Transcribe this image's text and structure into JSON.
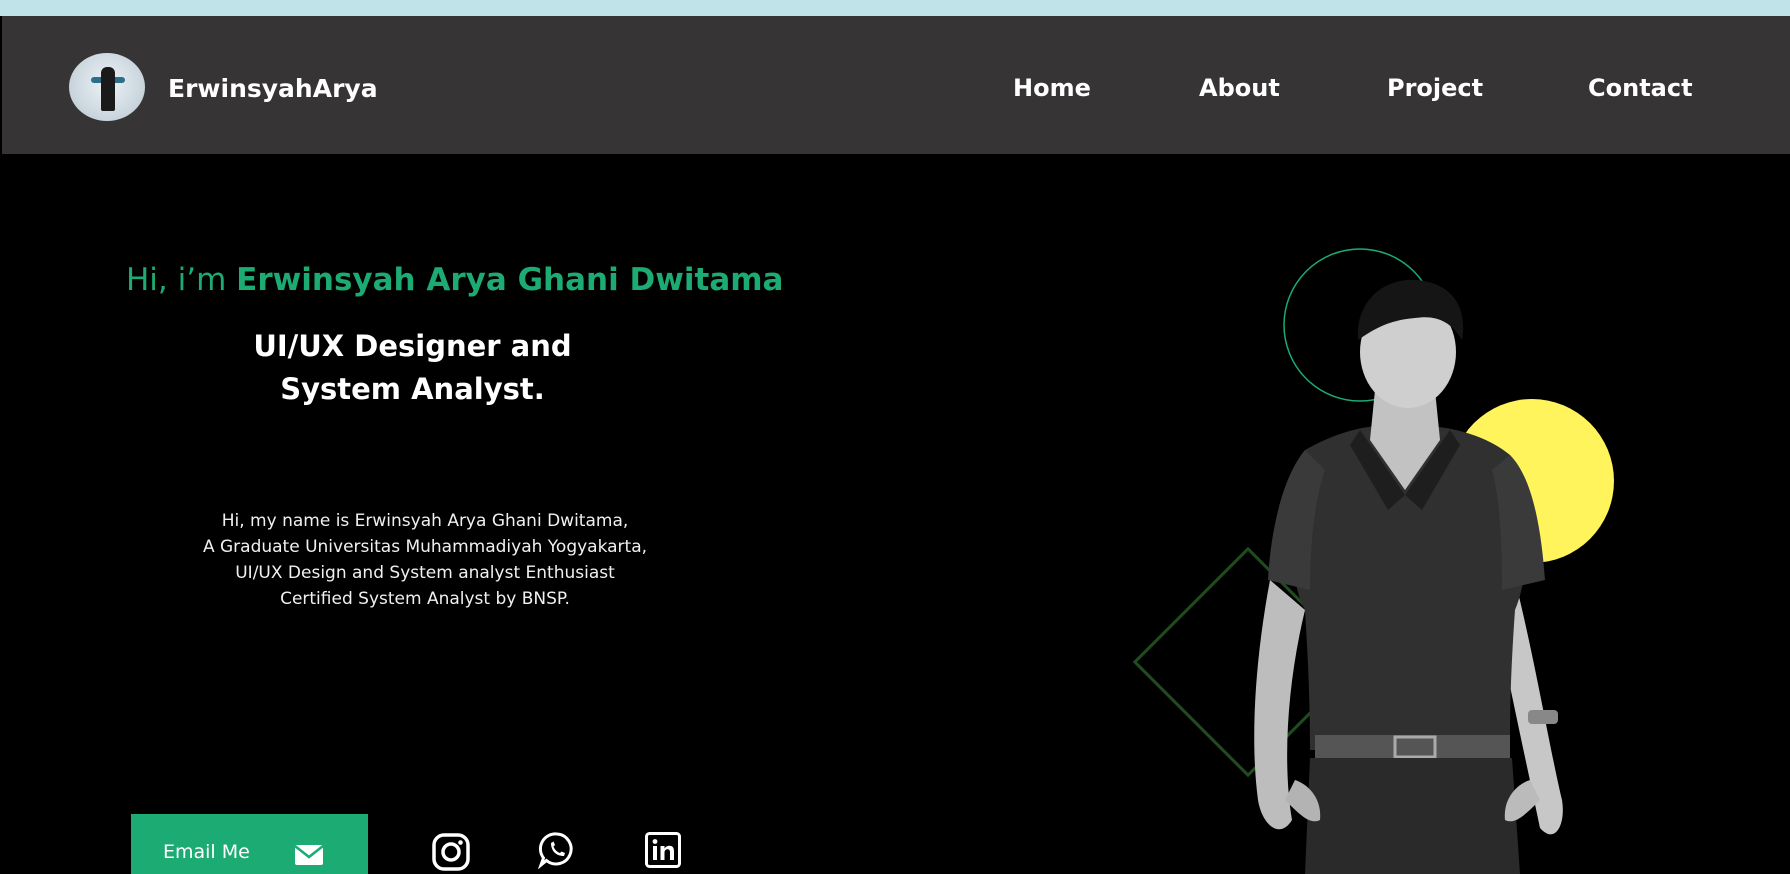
{
  "header": {
    "brand": "ErwinsyahArya",
    "nav": [
      {
        "label": "Home"
      },
      {
        "label": "About"
      },
      {
        "label": "Project"
      },
      {
        "label": "Contact"
      }
    ]
  },
  "hero": {
    "greeting_prefix": "Hi, i’m ",
    "name": "Erwinsyah Arya Ghani Dwitama",
    "role_lines": [
      "UI/UX  Designer and",
      "System Analyst."
    ],
    "bio_lines": [
      "Hi, my name is Erwinsyah Arya Ghani Dwitama,",
      "A Graduate Universitas Muhammadiyah Yogyakarta,",
      "UI/UX Design and System analyst Enthusiast",
      "Certified System Analyst by BNSP."
    ],
    "email_button": "Email Me"
  },
  "social_icons": [
    "instagram-icon",
    "whatsapp-icon",
    "linkedin-icon"
  ],
  "colors": {
    "accent": "#1cab72",
    "navbar": "#363435",
    "background": "#000000",
    "yellow": "#fff45c",
    "top_strip": "#bfe3e9"
  }
}
